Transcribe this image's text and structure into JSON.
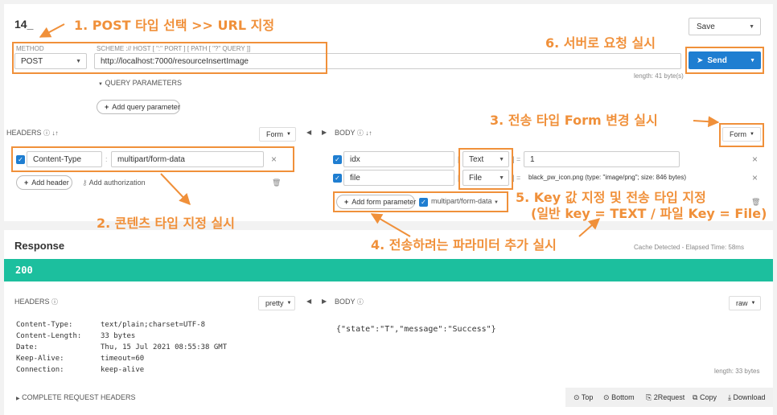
{
  "request": {
    "name": "14_",
    "method_label": "METHOD",
    "method_value": "POST",
    "scheme_label": "SCHEME :// HOST [ \":\" PORT ] [ PATH [ \"?\" QUERY ]]",
    "url": "http://localhost:7000/resourceInsertImage",
    "url_length": "length: 41 byte(s)",
    "query_toggle": "QUERY PARAMETERS",
    "add_query_param": "Add query parameter",
    "save_label": "Save",
    "send_label": "Send"
  },
  "headers": {
    "title": "HEADERS",
    "format": "Form",
    "key": "Content-Type",
    "value": "multipart/form-data",
    "add_header": "Add header",
    "add_auth": "Add authorization"
  },
  "body": {
    "title": "BODY",
    "format": "Form",
    "rows": [
      {
        "key": "idx",
        "type": "Text",
        "value": "1"
      },
      {
        "key": "file",
        "type": "File",
        "value": "black_pw_icon.png (type: \"image/png\"; size: 846 bytes)"
      }
    ],
    "add_form_param": "Add form parameter",
    "content_type": "multipart/form-data"
  },
  "response": {
    "title": "Response",
    "cache_info": "Cache Detected - Elapsed Time: 58ms",
    "status": "200",
    "headers_title": "HEADERS",
    "headers_format": "pretty",
    "header_rows": [
      {
        "name": "Content-Type:",
        "value": "text/plain;charset=UTF-8"
      },
      {
        "name": "Content-Length:",
        "value": "33 bytes"
      },
      {
        "name": "Date:",
        "value": "Thu, 15 Jul 2021 08:55:38 GMT"
      },
      {
        "name": "Keep-Alive:",
        "value": "timeout=60"
      },
      {
        "name": "Connection:",
        "value": "keep-alive"
      }
    ],
    "complete_headers": "COMPLETE REQUEST HEADERS",
    "body_title": "BODY",
    "body_format": "raw",
    "body_text": "{\"state\":\"T\",\"message\":\"Success\"}",
    "body_length": "length: 33 bytes",
    "actions": {
      "top": "Top",
      "bottom": "Bottom",
      "to_request": "2Request",
      "copy": "Copy",
      "download": "Download"
    }
  },
  "annotations": {
    "a1": "1. POST 타입 선택 >> URL 지정",
    "a2": "2. 콘텐츠 타입 지정 실시",
    "a3": "3. 전송 타입 Form 변경 실시",
    "a4": "4. 전송하려는 파라미터 추가 실시",
    "a5_line1": "5. Key 값 지정 및 전송 타입 지정",
    "a5_line2": "(일반 key = TEXT / 파일 Key = File)",
    "a6": "6. 서버로 요청 실시"
  },
  "colors": {
    "accent": "#1f7ed1",
    "status_bar": "#1cbf9e",
    "annotation": "#f0903a"
  }
}
